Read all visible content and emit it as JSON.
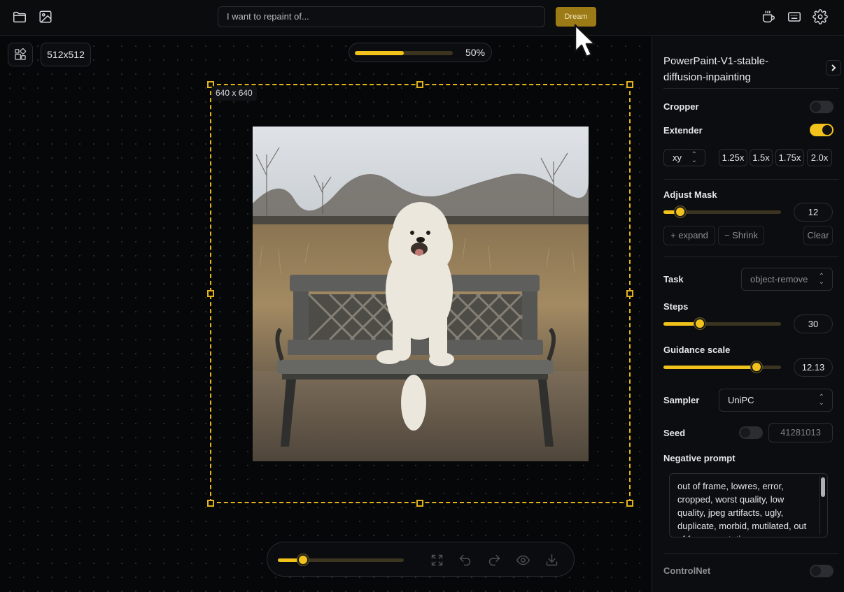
{
  "topbar": {
    "prompt_placeholder": "I want to repaint of...",
    "dream_label": "Dream",
    "icons": [
      "folder-icon",
      "image-icon",
      "coffee-icon",
      "keyboard-icon",
      "gear-icon"
    ]
  },
  "canvas": {
    "size_label": "512x512",
    "progress_label": "50%",
    "progress_value": 0.5,
    "frame_label": "640 x 640",
    "brush_size_value": 0.2,
    "tool_icons": [
      "fullscreen-icon",
      "undo-icon",
      "redo-icon",
      "eye-icon",
      "download-icon"
    ]
  },
  "panel": {
    "model_name": "PowerPaint-V1-stable-diffusion-inpainting",
    "cropper": {
      "label": "Cropper",
      "on": false
    },
    "extender": {
      "label": "Extender",
      "on": true,
      "direction": "xy",
      "scales": [
        "1.25x",
        "1.5x",
        "1.75x",
        "2.0x"
      ]
    },
    "adjust_mask": {
      "label": "Adjust Mask",
      "value": "12",
      "slider": 0.14,
      "expand": "+ expand",
      "shrink": "− Shrink",
      "clear": "Clear"
    },
    "task": {
      "label": "Task",
      "value": "object-remove"
    },
    "steps": {
      "label": "Steps",
      "value": "30",
      "slider": 0.31
    },
    "guidance": {
      "label": "Guidance scale",
      "value": "12.13",
      "slider": 0.79
    },
    "sampler": {
      "label": "Sampler",
      "value": "UniPC"
    },
    "seed": {
      "label": "Seed",
      "on": false,
      "value": "41281013"
    },
    "negative_prompt": {
      "label": "Negative prompt",
      "value": "out of frame, lowres, error, cropped, worst quality, low quality, jpeg artifacts, ugly, duplicate, morbid, mutilated, out of frame, mutation"
    },
    "controlnet": {
      "label": "ControlNet",
      "on": false
    }
  },
  "colors": {
    "accent": "#f1c21b",
    "dream_button": "#9c7b17",
    "background": "#07080a"
  }
}
